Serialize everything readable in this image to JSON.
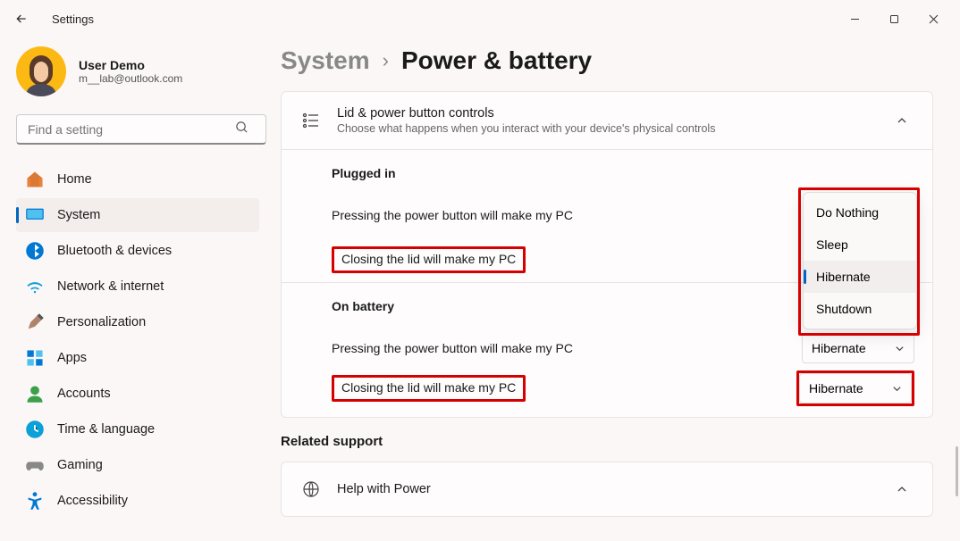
{
  "window": {
    "title": "Settings"
  },
  "profile": {
    "name": "User Demo",
    "email": "m__lab@outlook.com"
  },
  "search": {
    "placeholder": "Find a setting"
  },
  "nav": [
    {
      "label": "Home"
    },
    {
      "label": "System"
    },
    {
      "label": "Bluetooth & devices"
    },
    {
      "label": "Network & internet"
    },
    {
      "label": "Personalization"
    },
    {
      "label": "Apps"
    },
    {
      "label": "Accounts"
    },
    {
      "label": "Time & language"
    },
    {
      "label": "Gaming"
    },
    {
      "label": "Accessibility"
    }
  ],
  "breadcrumb": {
    "parent": "System",
    "current": "Power & battery"
  },
  "card": {
    "title": "Lid & power button controls",
    "subtitle": "Choose what happens when you interact with your device's physical controls"
  },
  "sections": {
    "plugged": {
      "title": "Plugged in",
      "power_btn": "Pressing the power button will make my PC",
      "lid": "Closing the lid will make my PC"
    },
    "battery": {
      "title": "On battery",
      "power_btn": "Pressing the power button will make my PC",
      "power_btn_val": "Hibernate",
      "lid": "Closing the lid will make my PC",
      "lid_val": "Hibernate"
    }
  },
  "menu": {
    "items": [
      "Do Nothing",
      "Sleep",
      "Hibernate",
      "Shutdown"
    ]
  },
  "related": {
    "title": "Related support",
    "help": "Help with Power"
  }
}
